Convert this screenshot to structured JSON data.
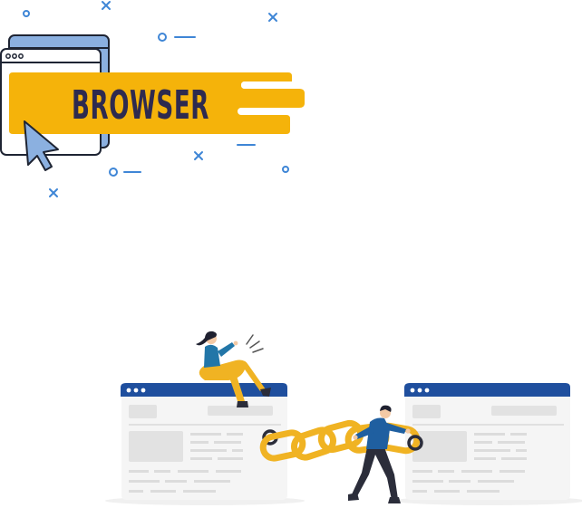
{
  "banner": {
    "label": "BROWSER",
    "colors": {
      "yellow": "#f5b30a",
      "navy": "#2e2a4f",
      "window_back": "#8bb0e0",
      "accent_blue": "#3f86d6",
      "stroke": "#1e2433"
    },
    "icons": [
      "browser-window-icon",
      "mouse-cursor-icon",
      "x-mark-icon",
      "circle-icon",
      "dash-icon"
    ]
  },
  "illustration": {
    "description_icons": [
      "web-page-icon",
      "chain-link-icon",
      "person-icon"
    ],
    "colors": {
      "browser_bar": "#1f4f9e",
      "chain": "#f0b323",
      "placeholder": "#e6e6e6",
      "woman_shirt": "#2276a8",
      "man_jacket": "#1f5fa0",
      "pants_dark": "#2b2d3a"
    }
  }
}
